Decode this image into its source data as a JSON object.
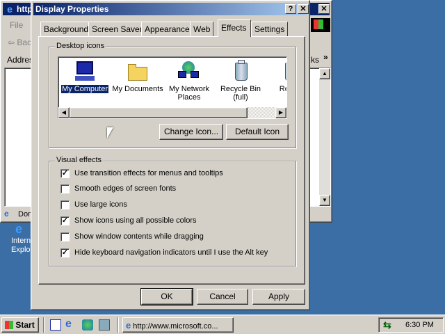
{
  "ie_window": {
    "title_fragment": "http",
    "menu_file": "File",
    "back_label": "Bac",
    "address_label": "Addres",
    "links_label": "ks",
    "status_fragment": "Don"
  },
  "desktop": {
    "ie_icon_label_1": "Intern",
    "ie_icon_label_2": "Explo"
  },
  "dialog": {
    "title": "Display Properties",
    "help_btn": "?",
    "close_btn": "✕",
    "tabs": [
      {
        "label": "Background"
      },
      {
        "label": "Screen Saver"
      },
      {
        "label": "Appearance"
      },
      {
        "label": "Web"
      },
      {
        "label": "Effects"
      },
      {
        "label": "Settings"
      }
    ],
    "active_tab": "Effects",
    "desktop_icons": {
      "group_label": "Desktop icons",
      "items": [
        {
          "label": "My Computer",
          "icon": "computer-icon"
        },
        {
          "label": "My Documents",
          "icon": "folder-icon"
        },
        {
          "label": "My Network Places",
          "icon": "network-icon"
        },
        {
          "label": "Recycle Bin (full)",
          "icon": "recycle-bin-full-icon"
        },
        {
          "label": "Rec (e",
          "icon": "recycle-bin-empty-icon"
        }
      ],
      "change_icon_button": "Change Icon...",
      "default_icon_button": "Default Icon"
    },
    "visual_effects": {
      "group_label": "Visual effects",
      "options": [
        {
          "label": "Use transition effects for menus and tooltips",
          "checked": true
        },
        {
          "label": "Smooth edges of screen fonts",
          "checked": false
        },
        {
          "label": "Use large icons",
          "checked": false
        },
        {
          "label": "Show icons using all possible colors",
          "checked": true
        },
        {
          "label": "Show window contents while dragging",
          "checked": false
        },
        {
          "label": "Hide keyboard navigation indicators until I use the Alt key",
          "checked": true
        }
      ]
    },
    "ok_button": "OK",
    "cancel_button": "Cancel",
    "apply_button": "Apply"
  },
  "taskbar": {
    "start_label": "Start",
    "task_button": "http://www.microsoft.co...",
    "clock": "6:30 PM"
  },
  "colors": {
    "title_active": "#0a246a",
    "desktop": "#3a6ea5",
    "face": "#d4d0c8"
  }
}
